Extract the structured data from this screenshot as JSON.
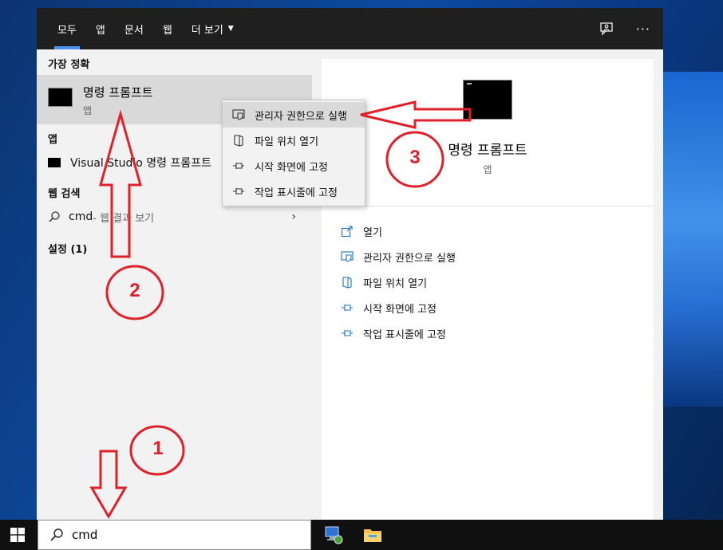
{
  "tabs": [
    {
      "label": "모두",
      "active": true
    },
    {
      "label": "앱"
    },
    {
      "label": "문서"
    },
    {
      "label": "웹"
    },
    {
      "label": "더 보기"
    }
  ],
  "top_icons": [
    "feedback-icon",
    "more-options-icon"
  ],
  "more_label": "···",
  "left": {
    "best_match_label": "가장 정확",
    "best_match": {
      "title": "명령 프롬프트",
      "subtitle": "앱"
    },
    "apps_label": "앱",
    "app_item": "Visual Studio 명령 프롬프트",
    "web_label": "웹 검색",
    "web_item": {
      "query": "cmd",
      "suffix": " - 웹 결과 보기"
    },
    "settings_label": "설정 (1)"
  },
  "context_menu": [
    {
      "label": "관리자 권한으로 실행",
      "icon": "shield-icon"
    },
    {
      "label": "파일 위치 열기",
      "icon": "file-location-icon"
    },
    {
      "label": "시작 화면에 고정",
      "icon": "pin-icon"
    },
    {
      "label": "작업 표시줄에 고정",
      "icon": "pin-icon"
    }
  ],
  "right": {
    "title": "명령 프롬프트",
    "subtitle": "앱",
    "actions": [
      {
        "label": "열기",
        "icon": "open-icon"
      },
      {
        "label": "관리자 권한으로 실행",
        "icon": "shield-icon"
      },
      {
        "label": "파일 위치 열기",
        "icon": "file-location-icon"
      },
      {
        "label": "시작 화면에 고정",
        "icon": "pin-icon"
      },
      {
        "label": "작업 표시줄에 고정",
        "icon": "pin-icon"
      }
    ]
  },
  "taskbar": {
    "search_value": "cmd"
  },
  "annotations": {
    "step1": "1",
    "step2": "2",
    "step3": "3"
  },
  "colors": {
    "accent": "#4b95f0",
    "annotation": "#e0202a",
    "topbar": "#1f1f1f"
  }
}
